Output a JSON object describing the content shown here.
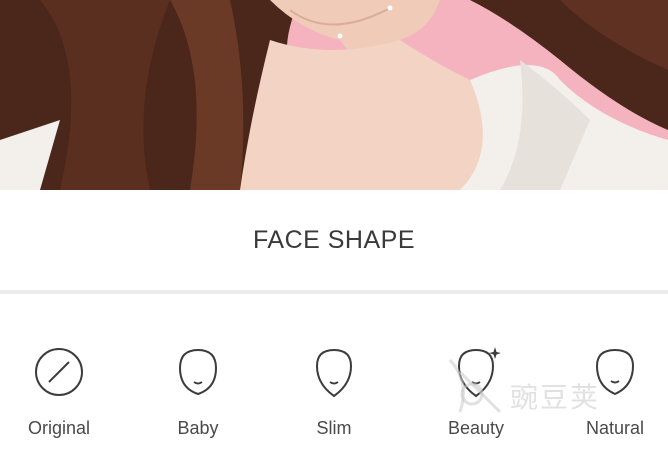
{
  "panel": {
    "title": "FACE SHAPE"
  },
  "options": [
    {
      "label": "Original",
      "icon": "original-icon"
    },
    {
      "label": "Baby",
      "icon": "baby-face-icon"
    },
    {
      "label": "Slim",
      "icon": "slim-face-icon"
    },
    {
      "label": "Beauty",
      "icon": "beauty-face-icon"
    },
    {
      "label": "Natural",
      "icon": "natural-face-icon"
    }
  ],
  "watermark": {
    "text": "豌豆荚"
  },
  "colors": {
    "background_pink": "#f4aab6",
    "hair": "#4a2418",
    "skin": "#f2d3c4",
    "shirt": "#f3efea",
    "text": "#3a3a3a",
    "divider": "#ececec"
  }
}
